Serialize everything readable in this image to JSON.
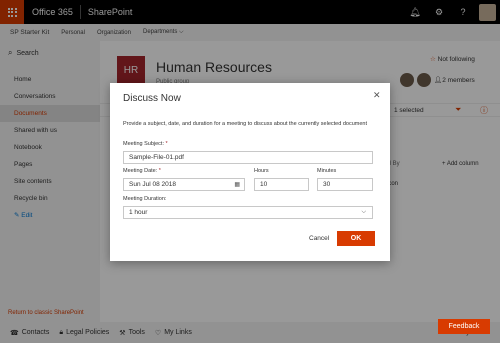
{
  "suitebar": {
    "brand": "Office 365",
    "app": "SharePoint"
  },
  "hubnav": {
    "title": "SP Starter Kit",
    "links": [
      "Personal",
      "Organization",
      "Departments ⌵"
    ]
  },
  "leftnav": {
    "search": "Search",
    "items": [
      {
        "label": "Home"
      },
      {
        "label": "Conversations"
      },
      {
        "label": "Documents"
      },
      {
        "label": "Shared with us"
      },
      {
        "label": "Notebook"
      },
      {
        "label": "Pages"
      },
      {
        "label": "Site contents"
      },
      {
        "label": "Recycle bin"
      }
    ],
    "edit": "Edit",
    "return": "Return to classic SharePoint"
  },
  "site": {
    "logo": "HR",
    "title": "Human Resources",
    "subtitle": "Public group",
    "follow": "Not following",
    "members": "2 members"
  },
  "list": {
    "selected": "1 selected",
    "col": "ified By",
    "add_column": "+ Add column",
    "cell": "Falcon"
  },
  "bottombar": {
    "items": [
      {
        "icon": "contacts-icon",
        "label": "Contacts"
      },
      {
        "icon": "lock-icon",
        "label": "Legal Policies"
      },
      {
        "icon": "tools-icon",
        "label": "Tools"
      },
      {
        "icon": "heart-icon",
        "label": "My Links"
      }
    ],
    "right": "Edit My Links"
  },
  "feedback": "Feedback",
  "dialog": {
    "title": "Discuss Now",
    "description": "Provide a subject, date, and duration for a meeting to discuss about the currently selected document",
    "subject_label": "Meeting Subject:",
    "subject_value": "Sample-File-01.pdf",
    "date_label": "Meeting Date:",
    "date_value": "Sun Jul 08 2018",
    "hours_label": "Hours",
    "hours_value": "10",
    "minutes_label": "Minutes",
    "minutes_value": "30",
    "duration_label": "Meeting Duration:",
    "duration_value": "1 hour",
    "cancel": "Cancel",
    "ok": "OK"
  },
  "colors": {
    "accent": "#d83b01",
    "logo": "#a4262c"
  }
}
